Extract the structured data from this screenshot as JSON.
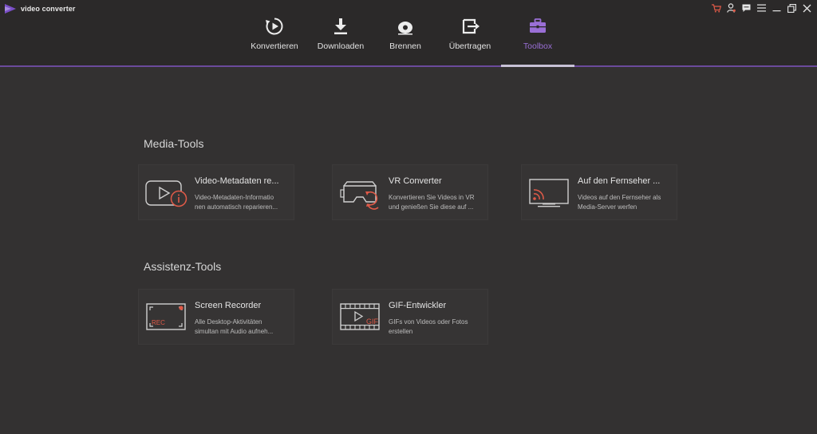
{
  "app": {
    "name": "video converter",
    "accent_color": "#9a6fd6",
    "icon_color": "#e05a48"
  },
  "window_controls": [
    {
      "icon": "cart-icon"
    },
    {
      "icon": "user-icon"
    },
    {
      "icon": "chat-icon"
    },
    {
      "icon": "menu-icon"
    },
    {
      "icon": "minimize-icon"
    },
    {
      "icon": "restore-icon"
    },
    {
      "icon": "close-icon"
    }
  ],
  "nav": {
    "items": [
      {
        "label": "Konvertieren",
        "icon": "convert-icon"
      },
      {
        "label": "Downloaden",
        "icon": "download-icon"
      },
      {
        "label": "Brennen",
        "icon": "burn-disc-icon"
      },
      {
        "label": "Übertragen",
        "icon": "transfer-icon"
      },
      {
        "label": "Toolbox",
        "icon": "toolbox-icon",
        "active": true
      }
    ]
  },
  "media_tools": {
    "title": "Media-Tools",
    "cards": [
      {
        "title": "Video-Metadaten re...",
        "desc_line1": "Video-Metadaten-Informatio",
        "desc_line2": "nen automatisch reparieren...",
        "icon": "video-metadata-icon"
      },
      {
        "title": "VR Converter",
        "desc_line1": "Konvertieren Sie Videos in VR",
        "desc_line2": "und genießen Sie diese auf ...",
        "icon": "vr-headset-icon"
      },
      {
        "title": "Auf den Fernseher ...",
        "desc_line1": "Videos auf den Fernseher als",
        "desc_line2": "Media-Server werfen",
        "icon": "cast-to-tv-icon"
      }
    ]
  },
  "assist_tools": {
    "title": "Assistenz-Tools",
    "cards": [
      {
        "title": "Screen Recorder",
        "desc_line1": "Alle Desktop-Aktivitäten",
        "desc_line2": "simultan mit Audio aufneh...",
        "icon": "screen-recorder-icon",
        "badge": "REC"
      },
      {
        "title": "GIF-Entwickler",
        "desc_line1": "GIFs von Videos oder Fotos",
        "desc_line2": "erstellen",
        "icon": "gif-maker-icon",
        "badge": "GIF"
      }
    ]
  }
}
